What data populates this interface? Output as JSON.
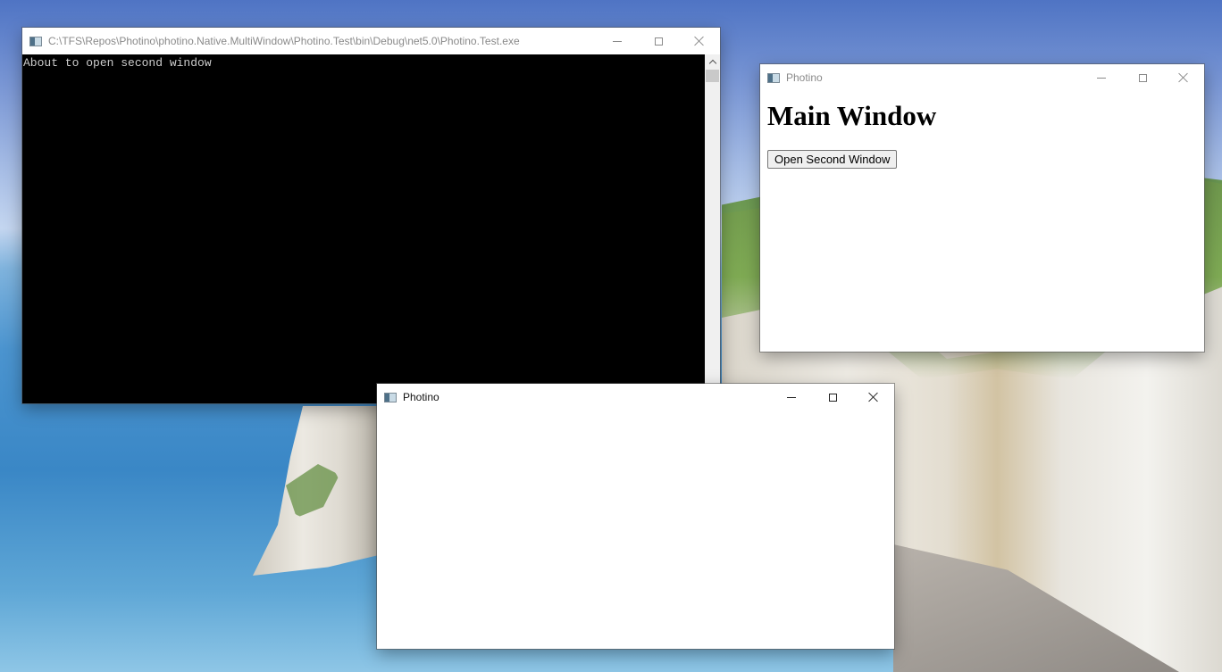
{
  "console_window": {
    "title": "C:\\TFS\\Repos\\Photino\\photino.Native.MultiWindow\\Photino.Test\\bin\\Debug\\net5.0\\Photino.Test.exe",
    "output_line": "About to open second window"
  },
  "main_window": {
    "title": "Photino",
    "heading": "Main Window",
    "button_label": "Open Second Window"
  },
  "second_window": {
    "title": "Photino"
  },
  "icons": [
    "app-icon",
    "minimize-icon",
    "maximize-icon",
    "close-icon",
    "chevron-up-icon"
  ]
}
